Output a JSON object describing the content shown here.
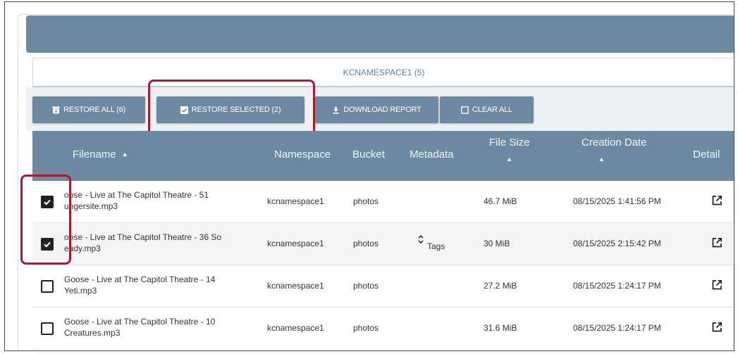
{
  "header": {
    "tab_label": "KCNAMESPACE1 (5)"
  },
  "toolbar": {
    "restore_all": "RESTORE ALL (6)",
    "restore_selected": "RESTORE SELECTED (2)",
    "download_report": "DOWNLOAD REPORT",
    "clear_all": "CLEAR ALL"
  },
  "table": {
    "columns": {
      "filename": "Filename",
      "namespace": "Namespace",
      "bucket": "Bucket",
      "metadata": "Metadata",
      "file_size": "File Size",
      "creation_date": "Creation Date",
      "detail": "Detail"
    },
    "sort_arrow": "▲",
    "rows": [
      {
        "checked": true,
        "filename_line1": "oose - Live at The Capitol Theatre - 51",
        "filename_line2": "ungersite.mp3",
        "namespace": "kcnamespace1",
        "bucket": "photos",
        "metadata": "",
        "file_size": "46.7 MiB",
        "creation_date": "08/15/2025 1:41:56 PM"
      },
      {
        "checked": true,
        "filename_line1": "oose - Live at The Capitol Theatre - 36 So",
        "filename_line2": "eady.mp3",
        "namespace": "kcnamespace1",
        "bucket": "photos",
        "metadata": "Tags",
        "file_size": "30 MiB",
        "creation_date": "08/15/2025 2:15:42 PM"
      },
      {
        "checked": false,
        "filename_line1": "Goose - Live at The Capitol Theatre - 14",
        "filename_line2": "Yeti.mp3",
        "namespace": "kcnamespace1",
        "bucket": "photos",
        "metadata": "",
        "file_size": "27.2 MiB",
        "creation_date": "08/15/2025 1:24:17 PM"
      },
      {
        "checked": false,
        "filename_line1": "Goose - Live at The Capitol Theatre - 10",
        "filename_line2": "Creatures.mp3",
        "namespace": "kcnamespace1",
        "bucket": "photos",
        "metadata": "",
        "file_size": "31.6 MiB",
        "creation_date": "08/15/2025 1:24:17 PM"
      }
    ]
  },
  "colors": {
    "accent": "#6e8aa3",
    "highlight": "#a51d2d",
    "tab_text": "#5c7fb0"
  },
  "icons": {
    "restore_all": "archive-restore-icon",
    "restore_selected": "checkbox-checked-icon",
    "download_report": "download-icon",
    "clear_all": "checkbox-empty-icon",
    "detail": "open-in-new-icon",
    "metadata": "unfold-icon"
  }
}
